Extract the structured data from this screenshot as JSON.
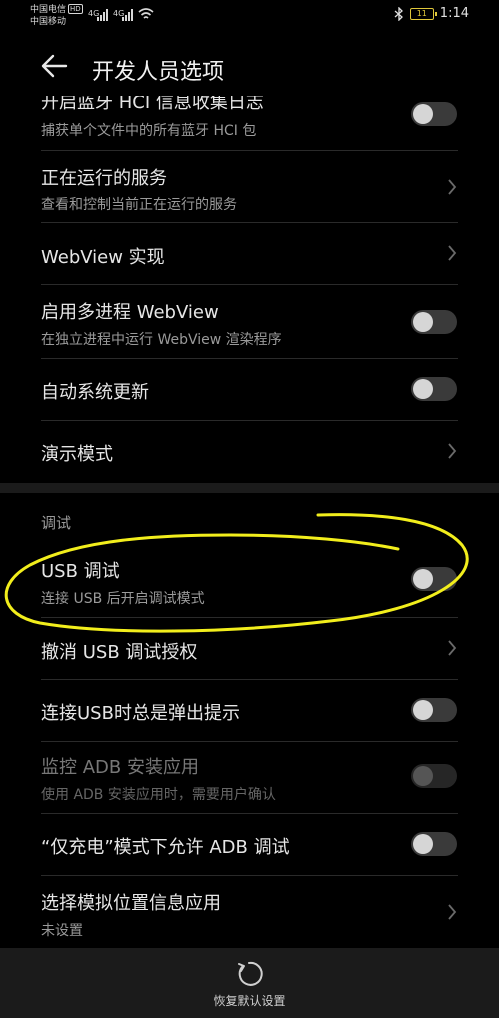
{
  "status": {
    "carrier1": "中国电信",
    "carrier1_badge": "HD",
    "carrier2": "中国移动",
    "signal1": "4G",
    "signal2": "4G",
    "battery": "11",
    "time": "1:14"
  },
  "app_bar": {
    "title": "开发人员选项"
  },
  "rows": {
    "hci": {
      "title": "开启蓝牙 HCI 信息收集日志",
      "subtitle": "捕获单个文件中的所有蓝牙 HCI 包"
    },
    "running_services": {
      "title": "正在运行的服务",
      "subtitle": "查看和控制当前正在运行的服务"
    },
    "webview_impl": {
      "title": "WebView 实现"
    },
    "multiprocess_webview": {
      "title": "启用多进程 WebView",
      "subtitle": "在独立进程中运行 WebView 渲染程序"
    },
    "auto_update": {
      "title": "自动系统更新"
    },
    "demo_mode": {
      "title": "演示模式"
    }
  },
  "debug_section": {
    "header": "调试",
    "usb_debug": {
      "title": "USB 调试",
      "subtitle": "连接 USB 后开启调试模式"
    },
    "revoke_usb": {
      "title": "撤消 USB 调试授权"
    },
    "usb_popup": {
      "title": "连接USB时总是弹出提示"
    },
    "adb_monitor": {
      "title": "监控 ADB 安装应用",
      "subtitle": "使用 ADB 安装应用时，需要用户确认"
    },
    "charge_only_adb": {
      "title": "“仅充电”模式下允许 ADB 调试"
    },
    "mock_location": {
      "title": "选择模拟位置信息应用",
      "subtitle": "未设置"
    }
  },
  "bottom_bar": {
    "restore_label": "恢复默认设置"
  },
  "colors": {
    "background": "#000000",
    "highlight_annotation": "#f2ee1c",
    "battery": "#e0c83a"
  }
}
